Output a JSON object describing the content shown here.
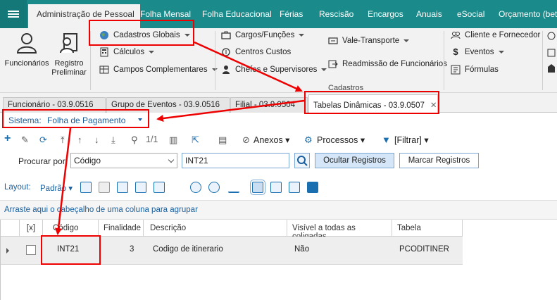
{
  "menu": {
    "tabs": [
      "Administração de Pessoal",
      "Folha Mensal",
      "Folha Educacional",
      "Férias",
      "Rescisão",
      "Encargos",
      "Anuais",
      "eSocial",
      "Orçamento (beta"
    ]
  },
  "ribbon": {
    "funcionarios": "Funcionários",
    "registro_preliminar_1": "Registro",
    "registro_preliminar_2": "Preliminar",
    "cadastros_globais": "Cadastros Globais",
    "calculos": "Cálculos",
    "campos_complementares": "Campos Complementares",
    "cargos_funcoes": "Cargos/Funções",
    "centros_custos": "Centros Custos",
    "chefes_supervisores": "Chefes e Supervisores",
    "vale_transporte": "Vale-Transporte",
    "readmissao": "Readmissão de Funcionários",
    "group_cadastros": "Cadastros",
    "cliente_fornecedor": "Cliente e Fornecedor",
    "eventos": "Eventos",
    "formulas": "Fórmulas"
  },
  "doc_tabs": [
    {
      "label": "Funcionário - 03.9.0516"
    },
    {
      "label": "Grupo de Eventos - 03.9.0516"
    },
    {
      "label": "Filial - 03.9.0504"
    },
    {
      "label": "Tabelas Dinâmicas - 03.9.0507"
    }
  ],
  "sistema": {
    "label": "Sistema:",
    "value": "Folha de Pagamento"
  },
  "toolbar": {
    "page": "1/1",
    "anexos": "Anexos",
    "processos": "Processos",
    "filtrar": "[Filtrar]"
  },
  "search": {
    "label": "Procurar por:",
    "field": "Código",
    "value": "INT21",
    "ocultar": "Ocultar Registros",
    "marcar": "Marcar Registros"
  },
  "layout": {
    "label": "Layout:",
    "value": "Padrão"
  },
  "groupby": "Arraste aqui o cabeçalho de uma coluna para agrupar",
  "grid": {
    "headers": [
      "[x]",
      "Código",
      "Finalidade",
      "Descrição",
      "Visível a todas as coligadas",
      "Tabela"
    ],
    "rows": [
      {
        "codigo": "INT21",
        "finalidade": "3",
        "descricao": "Codigo de itinerario",
        "visivel": "Não",
        "tabela": "PCODITINER"
      }
    ]
  },
  "colors": {
    "menu_bg": "#1a8a8a",
    "annotation": "#e00000",
    "link_blue": "#1a5f9e"
  }
}
